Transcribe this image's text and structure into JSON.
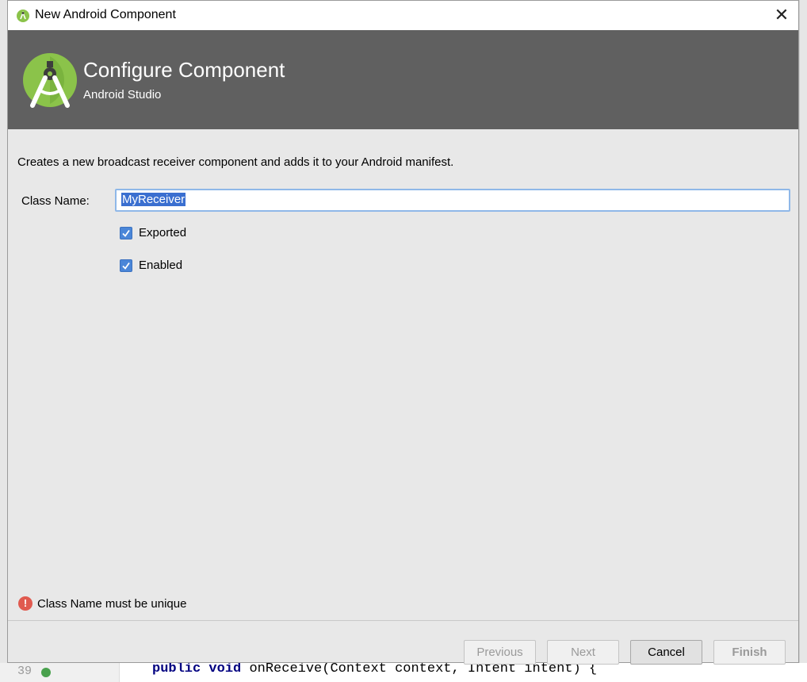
{
  "ide_background": {
    "line_number": "39",
    "code_keyword_1": "public",
    "code_keyword_2": "void",
    "code_rest": "onReceive(Context context, Intent intent) {"
  },
  "window": {
    "title": "New Android Component",
    "close_glyph": "✕"
  },
  "header": {
    "heading": "Configure Component",
    "subheading": "Android Studio",
    "logo_icon": "android-studio-logo-icon"
  },
  "form": {
    "description": "Creates a new broadcast receiver component and adds it to your Android manifest.",
    "class_name_label": "Class Name:",
    "class_name_value": "MyReceiver",
    "exported_label": "Exported",
    "exported_checked": true,
    "enabled_label": "Enabled",
    "enabled_checked": true
  },
  "validation": {
    "message": "Class Name must be unique",
    "icon_glyph": "!"
  },
  "buttons": {
    "previous": "Previous",
    "next": "Next",
    "cancel": "Cancel",
    "finish": "Finish"
  },
  "colors": {
    "banner": "#606060",
    "checkbox": "#4a86d8",
    "error": "#e05a4f",
    "android_green": "#8bc34a"
  }
}
